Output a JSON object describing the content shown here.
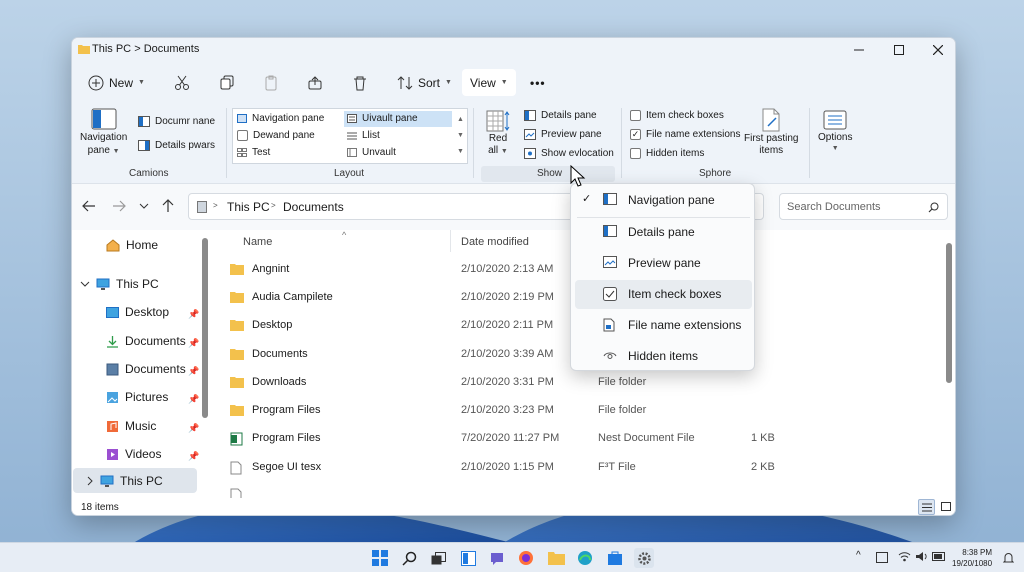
{
  "window": {
    "breadcrumb_root": "This PC",
    "breadcrumb_sep": ">",
    "breadcrumb_leaf": "Documents"
  },
  "toolbar": {
    "new_label": "New",
    "sort_label": "Sort",
    "view_label": "View",
    "more_label": "•••"
  },
  "ribbon": {
    "camions": {
      "label": "Camions",
      "navigation_pane": "Navigation",
      "navigation_pane2": "pane",
      "documents_pane": "Documr nane",
      "details_pane": "Details pwars"
    },
    "layout": {
      "label": "Layout",
      "items": [
        "Navigation pane",
        "Uivault pane",
        "Dewand pane",
        "Llist",
        "Test",
        "Unvault"
      ]
    },
    "show": {
      "label": "Show",
      "red_all": "Red",
      "red_all2": "all",
      "details_pane": "Details pane",
      "preview_pane": "Preview pane",
      "show_evlocation": "Show evlocation"
    },
    "sphore": {
      "label": "Sphore",
      "item_check_boxes": "Item check boxes",
      "file_name_extensions": "File name extensions",
      "hidden_items": "Hidden items",
      "first_pasting": "First pasting",
      "first_pasting2": "items",
      "options": "Options",
      "checks": {
        "item_check_boxes": false,
        "file_name_extensions": true,
        "hidden_items": false
      }
    }
  },
  "address": {
    "seg1": "This PC",
    "sep": ">",
    "seg2": "Documents",
    "search_placeholder": "Search Documents"
  },
  "sidebar": {
    "home": "Home",
    "this_pc": "This PC",
    "items": [
      "Desktop",
      "Documents",
      "Documents",
      "Pictures",
      "Music",
      "Videos"
    ],
    "this_pc_bottom": "This PC"
  },
  "columns": {
    "name": "Name",
    "date": "Date modified"
  },
  "files": [
    {
      "name": "Angnint",
      "date": "2/10/2020 2:13 AM",
      "type": "",
      "size": "",
      "kind": "folder"
    },
    {
      "name": "Audia Campilete",
      "date": "2/10/2020 2:19 PM",
      "type": "",
      "size": "",
      "kind": "folder"
    },
    {
      "name": "Desktop",
      "date": "2/10/2020 2:11 PM",
      "type": "",
      "size": "",
      "kind": "folder"
    },
    {
      "name": "Documents",
      "date": "2/10/2020 3:39 AM",
      "type": "",
      "size": "",
      "kind": "folder"
    },
    {
      "name": "Downloads",
      "date": "2/10/2020 3:31 PM",
      "type": "File folder",
      "size": "",
      "kind": "folder"
    },
    {
      "name": "Program Files",
      "date": "2/10/2020 3:23 PM",
      "type": "File folder",
      "size": "",
      "kind": "folder"
    },
    {
      "name": "Program Files",
      "date": "7/20/2020 11:27 PM",
      "type": "Nest Document File",
      "size": "1 KB",
      "kind": "excel"
    },
    {
      "name": "Segoe UI tesx",
      "date": "2/10/2020 1:15 PM",
      "type": "F³T File",
      "size": "2 KB",
      "kind": "doc"
    }
  ],
  "status": {
    "count": "18 items"
  },
  "view_menu": {
    "items": [
      {
        "label": "Navigation pane",
        "checked": true,
        "icon": "navigation-pane-icon"
      },
      {
        "label": "Details pane",
        "checked": false,
        "icon": "details-pane-icon"
      },
      {
        "label": "Preview pane",
        "checked": false,
        "icon": "preview-pane-icon"
      },
      {
        "label": "Item check boxes",
        "checked": false,
        "icon": "checkbox-icon"
      },
      {
        "label": "File name extensions",
        "checked": false,
        "icon": "file-extension-icon"
      },
      {
        "label": "Hidden items",
        "checked": false,
        "icon": "hidden-items-icon"
      }
    ]
  },
  "clock": {
    "time": "8:38 PM",
    "date": "19/20/1080"
  },
  "colors": {
    "accent": "#0067c0",
    "folder": "#f3c14c",
    "ribbon_bg": "#eef3f9"
  }
}
